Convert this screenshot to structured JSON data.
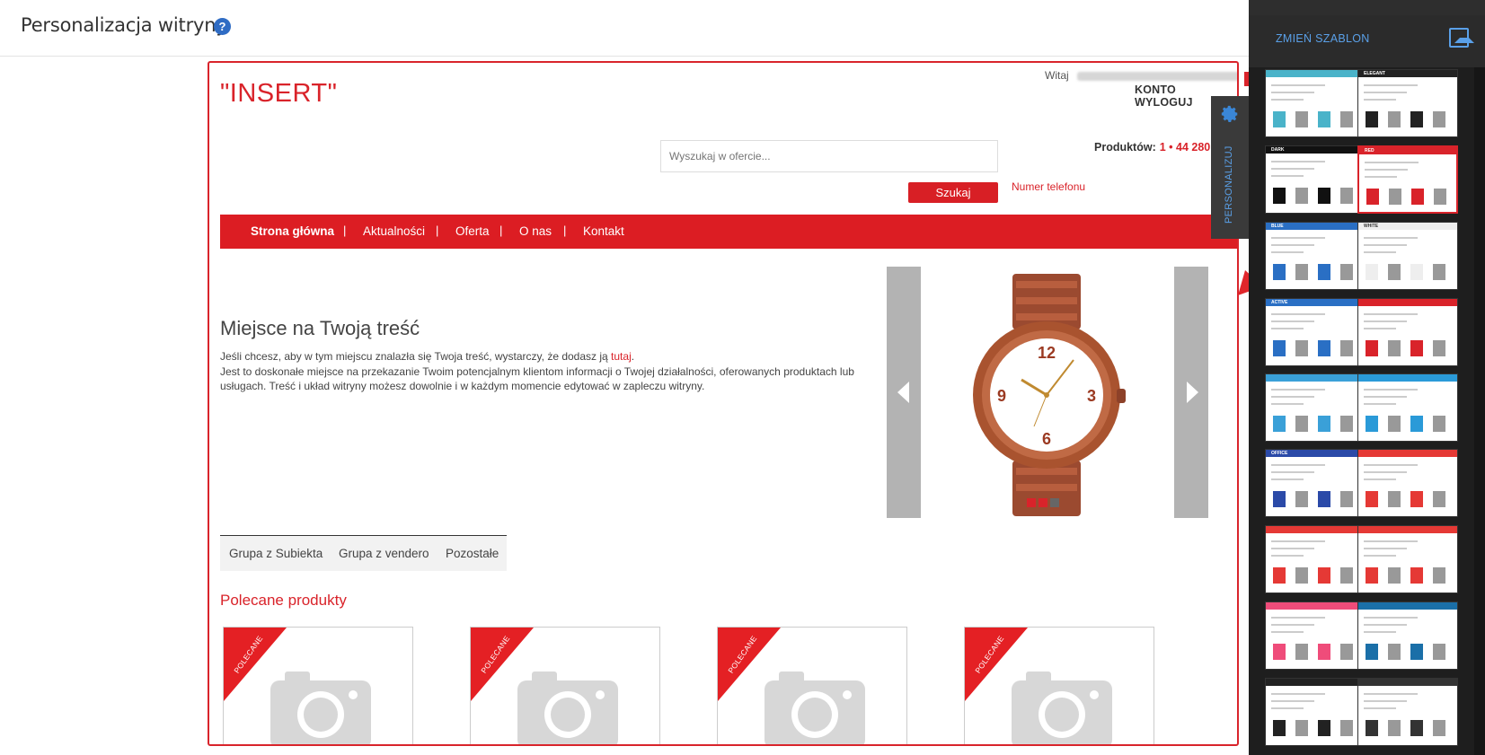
{
  "app": {
    "title": "Personalizacja witryny",
    "help_icon": "?"
  },
  "store": {
    "brand": "\"INSERT\"",
    "greeting": "Witaj",
    "account_link": "KONTO",
    "logout_link": "WYLOGUJ",
    "cart_label": "Produktów:",
    "cart_value": "1 • 44 280",
    "search": {
      "placeholder": "Wyszukaj w ofercie...",
      "button": "Szukaj"
    },
    "phone": "Numer telefonu",
    "nav": [
      "Strona główna",
      "Aktualności",
      "Oferta",
      "O nas",
      "Kontakt"
    ],
    "nav_separator": "|",
    "content": {
      "title": "Miejsce na Twoją treść",
      "text_before_link": "Jeśli chcesz, aby w tym miejscu znalazła się Twoja treść, wystarczy, że dodasz ją ",
      "link": "tutaj",
      "text_after_link": ".",
      "text_2": "Jest to doskonałe miejsce na przekazanie Twoim potencjalnym klientom informacji o Twojej działalności, oferowanych produktach lub usługach. Treść i układ witryny możesz dowolnie i w każdym momencie edytować w zapleczu witryny."
    },
    "slider": {
      "active_index": 0,
      "dot_count": 3
    },
    "tabs": [
      "Grupa z Subiekta",
      "Grupa z vendero",
      "Pozostałe"
    ],
    "recommended_title": "Polecane produkty",
    "product_badge": "POLECANE",
    "product_count": 4
  },
  "personalize_tab": {
    "label": "PERSONALIZUJ",
    "icon": "gear-icon"
  },
  "side_panel": {
    "change_template": "ZMIEŃ SZABLON",
    "pick_icon": "image-picker-icon",
    "templates": [
      {
        "label": "",
        "accent": "#4ab3c9",
        "selected": false
      },
      {
        "label": "ELEGANT",
        "accent": "#222222",
        "selected": false
      },
      {
        "label": "DARK",
        "accent": "#111111",
        "selected": false
      },
      {
        "label": "RED",
        "accent": "#d9232a",
        "selected": true
      },
      {
        "label": "BLUE",
        "accent": "#2a6fc4",
        "selected": false
      },
      {
        "label": "WHITE",
        "accent": "#eeeeee",
        "selected": false
      },
      {
        "label": "ACTIVE",
        "accent": "#2a6fc4",
        "selected": false
      },
      {
        "label": "",
        "accent": "#d9232a",
        "selected": false
      },
      {
        "label": "",
        "accent": "#3aa0d8",
        "selected": false
      },
      {
        "label": "",
        "accent": "#2a9ad8",
        "selected": false
      },
      {
        "label": "OFFICE",
        "accent": "#2b4aa8",
        "selected": false
      },
      {
        "label": "",
        "accent": "#e53935",
        "selected": false
      },
      {
        "label": "",
        "accent": "#e53935",
        "selected": false
      },
      {
        "label": "",
        "accent": "#e53935",
        "selected": false
      },
      {
        "label": "",
        "accent": "#ef4c7a",
        "selected": false
      },
      {
        "label": "",
        "accent": "#1a6fa8",
        "selected": false
      },
      {
        "label": "",
        "accent": "#222222",
        "selected": false
      },
      {
        "label": "",
        "accent": "#333333",
        "selected": false
      }
    ]
  },
  "colors": {
    "brand_red": "#d9232a",
    "panel_dark": "#1e1e1e",
    "panel_link": "#5aa0e8"
  }
}
